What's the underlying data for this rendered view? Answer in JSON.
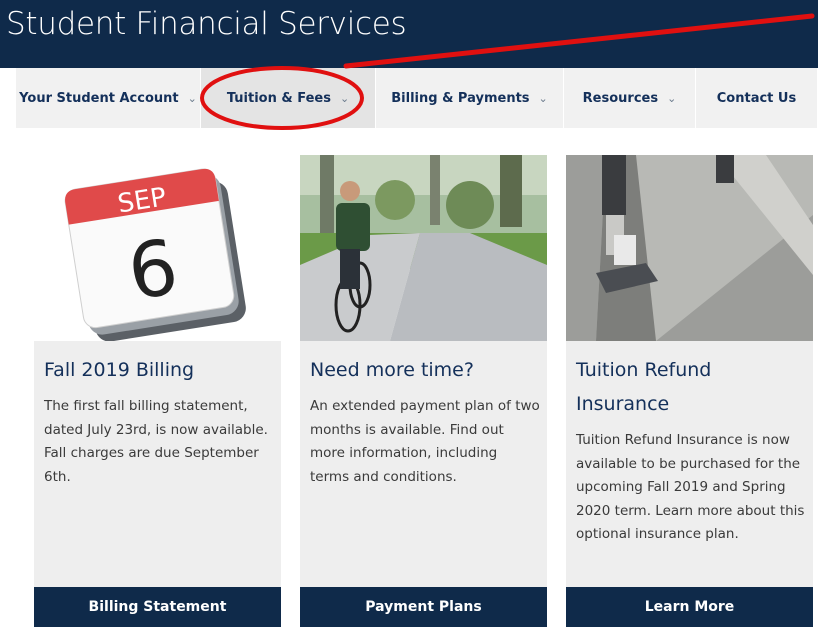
{
  "header": {
    "title": "Student Financial Services"
  },
  "nav": {
    "items": [
      {
        "label": "Your Student Account",
        "has_dropdown": true
      },
      {
        "label": "Tuition & Fees",
        "has_dropdown": true
      },
      {
        "label": "Billing & Payments",
        "has_dropdown": true
      },
      {
        "label": "Resources",
        "has_dropdown": true
      },
      {
        "label": "Contact Us",
        "has_dropdown": false
      }
    ],
    "highlighted": "Tuition & Fees"
  },
  "annotation": {
    "color": "#e01010"
  },
  "cards": [
    {
      "image": "calendar-icon",
      "calendar_month": "SEP",
      "calendar_day": "6",
      "title": "Fall 2019 Billing",
      "text": "The first fall billing statement, dated July 23rd, is now available. Fall charges are due September 6th.",
      "button": "Billing Statement"
    },
    {
      "image": "student-cycling-photo",
      "title": "Need more time?",
      "text": "An extended payment plan of two months is available. Find out more information, including terms and conditions.",
      "button": "Payment Plans"
    },
    {
      "image": "runner-on-steps-photo",
      "title": "Tuition Refund Insurance",
      "text": "Tuition Refund Insurance is now available to be purchased for the upcoming Fall 2019 and Spring 2020 term. Learn more about this optional insurance plan.",
      "button": "Learn More"
    }
  ],
  "colors": {
    "navy": "#0f2a4a",
    "nav_bg": "#f1f1f1",
    "card_bg": "#eeeeee",
    "title_text": "#14305a",
    "calendar_red": "#e04a4a"
  }
}
